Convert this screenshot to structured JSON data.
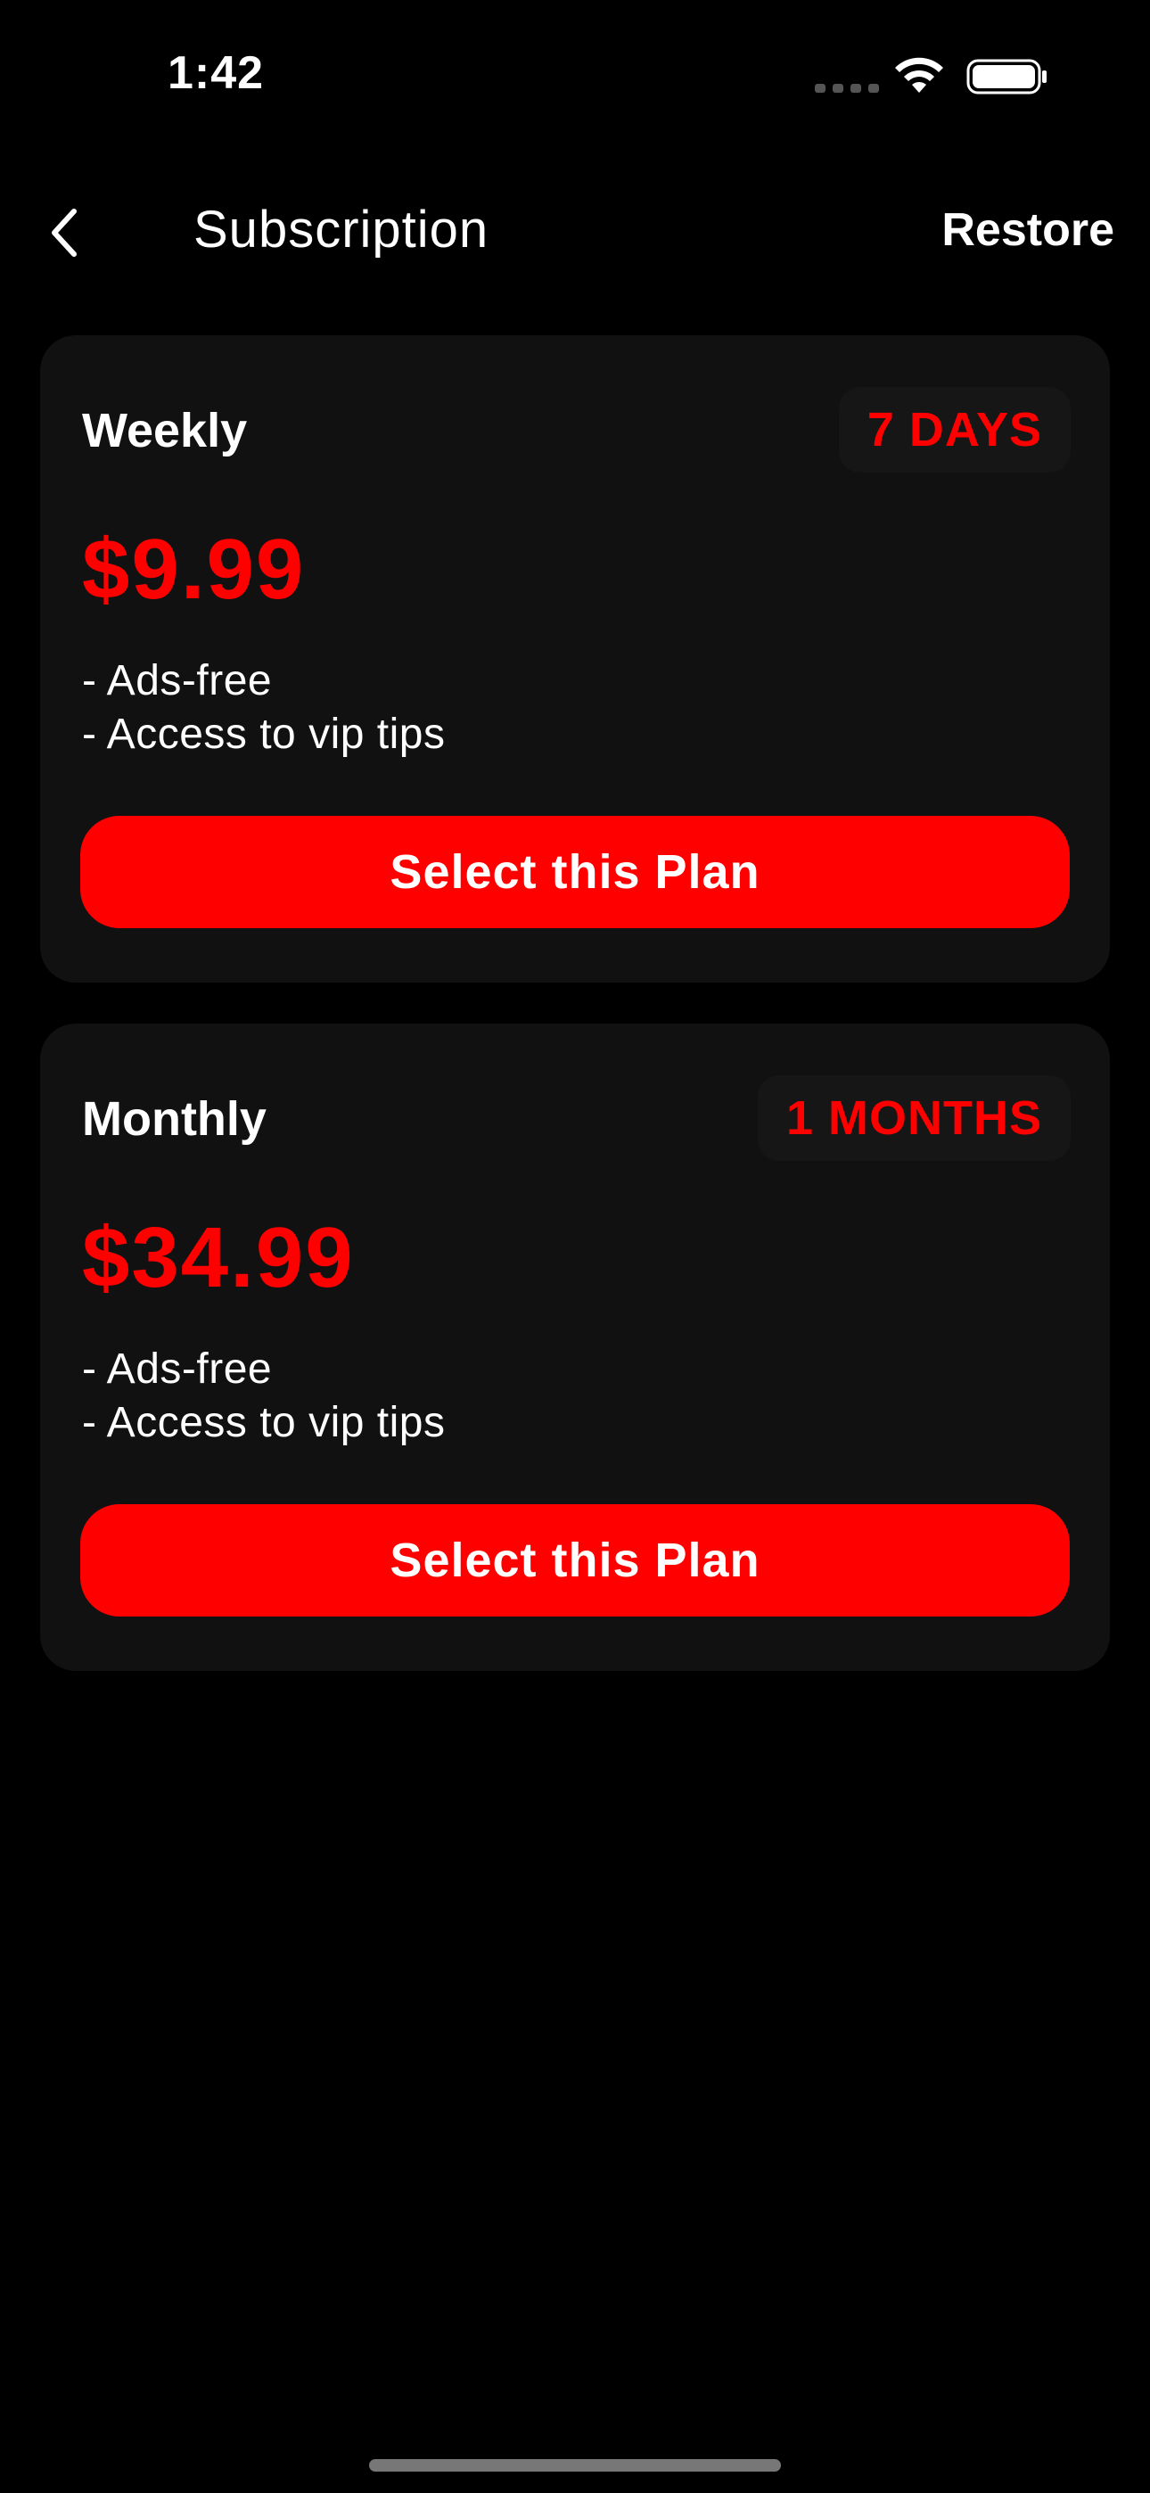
{
  "status_bar": {
    "time": "1:42"
  },
  "nav": {
    "title": "Subscription",
    "restore_label": "Restore"
  },
  "plans": [
    {
      "name": "Weekly",
      "duration": "7 DAYS",
      "price": "$9.99",
      "features": [
        "- Ads-free",
        "- Access to vip tips"
      ],
      "button_label": "Select this Plan"
    },
    {
      "name": "Monthly",
      "duration": "1 MONTHS",
      "price": "$34.99",
      "features": [
        "- Ads-free",
        "- Access to vip tips"
      ],
      "button_label": "Select this Plan"
    }
  ],
  "icons": {
    "back": "chevron-left-icon",
    "wifi": "wifi-icon",
    "battery": "battery-icon",
    "signal": "cellular-signal-icon"
  },
  "colors": {
    "background": "#000000",
    "card": "#111111",
    "accent": "#ff0000",
    "text": "#ffffff"
  }
}
